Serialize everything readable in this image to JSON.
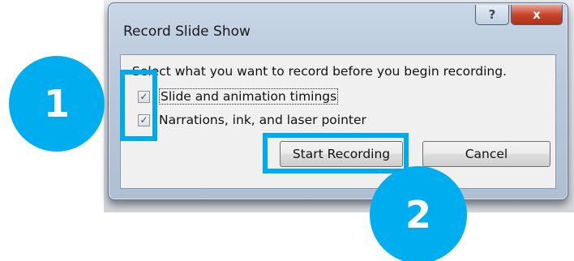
{
  "dialog": {
    "title": "Record Slide Show",
    "help_glyph": "?",
    "close_glyph": "x",
    "instruction": "Select what you want to record before you begin recording.",
    "options": [
      {
        "label": "Slide and animation timings",
        "checked": true
      },
      {
        "label": "Narrations, ink, and laser pointer",
        "checked": true
      }
    ],
    "buttons": {
      "start": "Start Recording",
      "cancel": "Cancel"
    }
  },
  "annotations": {
    "badge_1": "1",
    "badge_2": "2",
    "accent_color": "#00aeef"
  },
  "icons": {
    "checkbox_mark": "✓"
  }
}
